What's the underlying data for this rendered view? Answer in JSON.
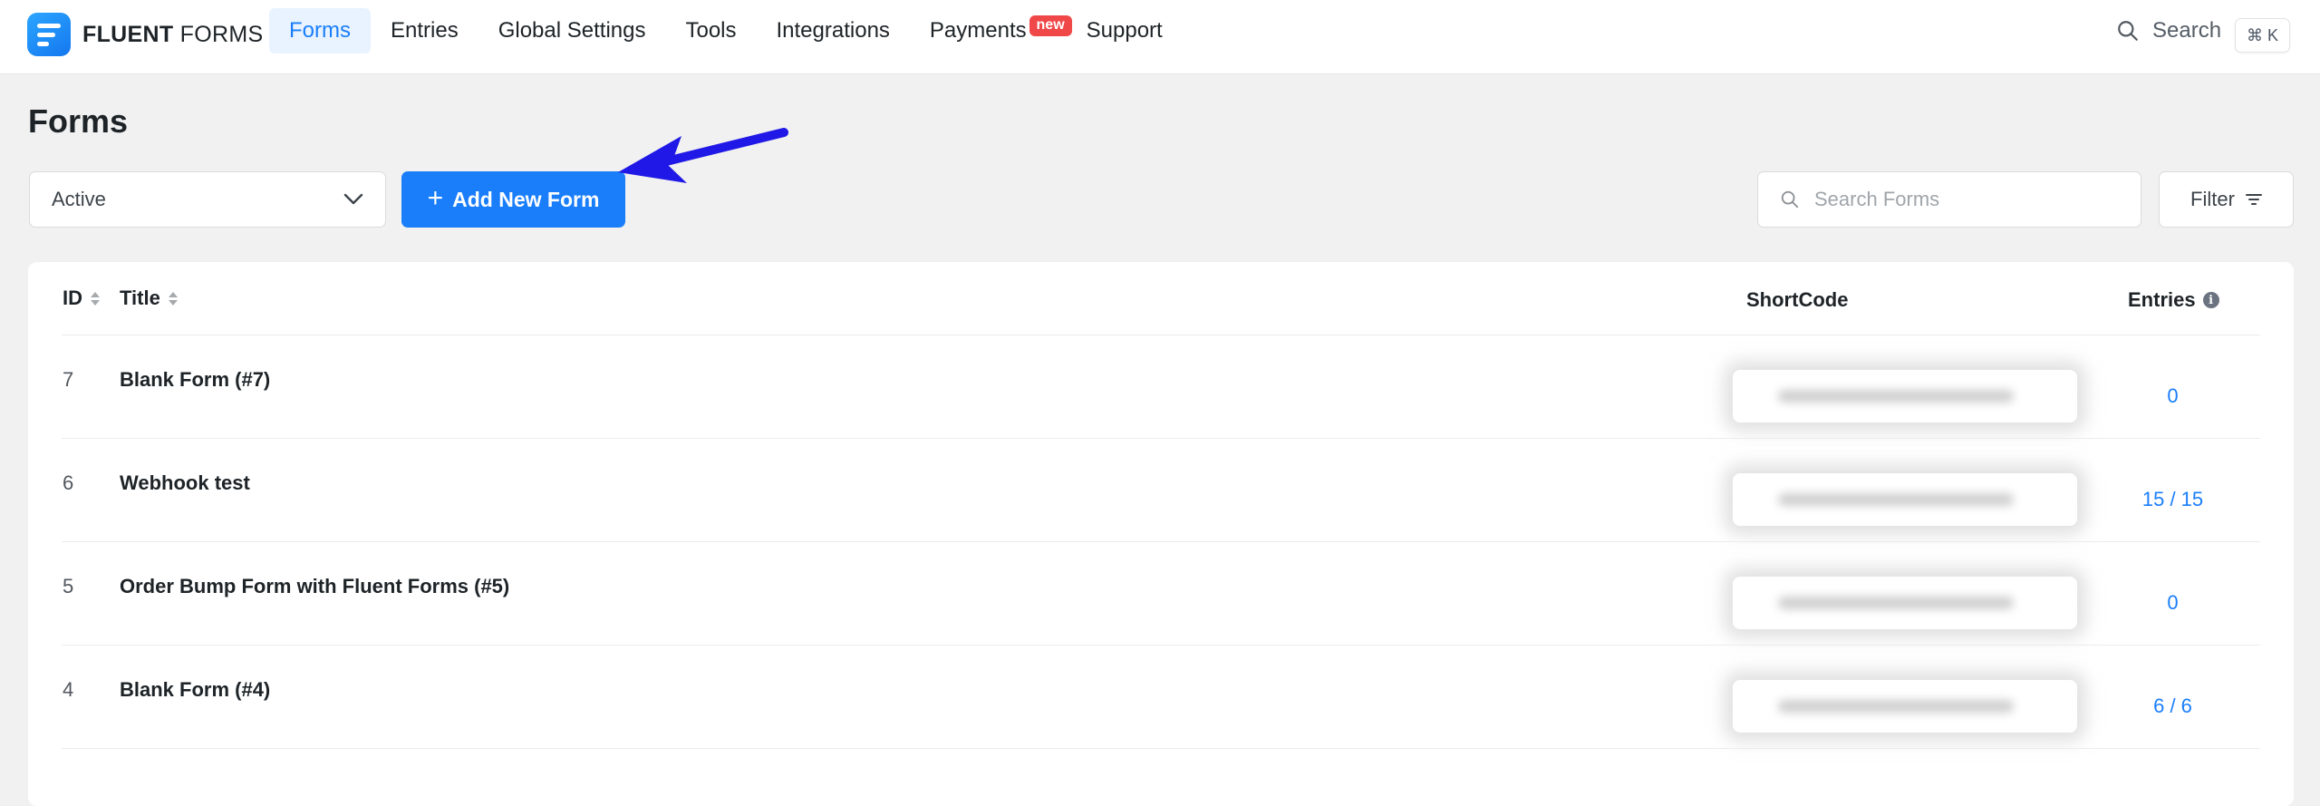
{
  "brand": {
    "name_bold": "FLUENT",
    "name_light": " FORMS"
  },
  "nav": [
    {
      "label": "Forms",
      "active": true
    },
    {
      "label": "Entries"
    },
    {
      "label": "Global Settings"
    },
    {
      "label": "Tools"
    },
    {
      "label": "Integrations"
    },
    {
      "label": "Payments",
      "badge": "new"
    },
    {
      "label": "Support"
    }
  ],
  "top_search": {
    "label": "Search",
    "shortcut": "⌘ K"
  },
  "page": {
    "title": "Forms"
  },
  "controls": {
    "status_value": "Active",
    "add_button": "Add New Form",
    "search_placeholder": "Search Forms",
    "filter_label": "Filter"
  },
  "table": {
    "columns": {
      "id": "ID",
      "title": "Title",
      "shortcode": "ShortCode",
      "entries": "Entries"
    },
    "rows": [
      {
        "id": "7",
        "title": "Blank Form (#7)",
        "entries": "0"
      },
      {
        "id": "6",
        "title": "Webhook test",
        "entries": "15 / 15"
      },
      {
        "id": "5",
        "title": "Order Bump Form with Fluent Forms (#5)",
        "entries": "0"
      },
      {
        "id": "4",
        "title": "Blank Form (#4)",
        "entries": "6 / 6"
      }
    ]
  },
  "colors": {
    "accent": "#1a7efb",
    "badge": "#f04848",
    "arrow": "#1f18e6"
  }
}
